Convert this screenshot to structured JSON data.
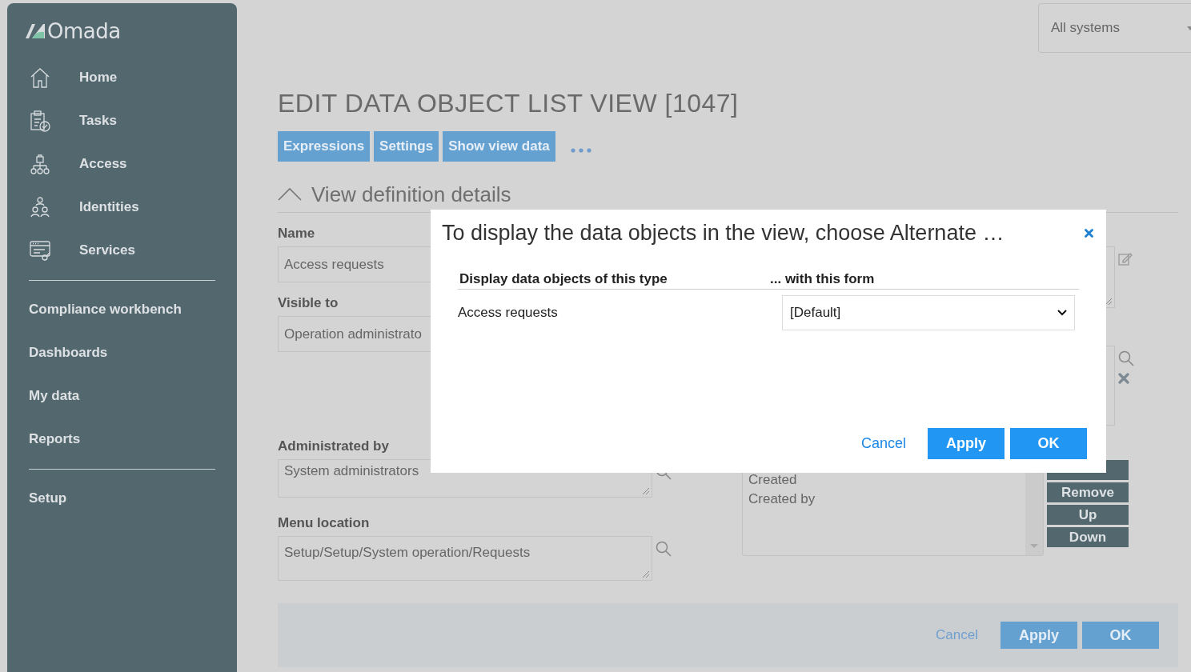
{
  "sidebar": {
    "logo": "Omada",
    "primary_items": [
      {
        "label": "Home"
      },
      {
        "label": "Tasks"
      },
      {
        "label": "Access"
      },
      {
        "label": "Identities"
      },
      {
        "label": "Services"
      }
    ],
    "secondary_items": [
      {
        "label": "Compliance workbench"
      },
      {
        "label": "Dashboards"
      },
      {
        "label": "My data"
      },
      {
        "label": "Reports"
      }
    ],
    "setup_items": [
      {
        "label": "Setup"
      }
    ]
  },
  "system_selector": {
    "value": "All systems"
  },
  "page": {
    "title": "EDIT DATA OBJECT LIST VIEW [1047]",
    "actions": [
      "Expressions",
      "Settings",
      "Show view data"
    ],
    "section": {
      "title": "View definition details",
      "expanded": true
    },
    "fields": [
      {
        "kind": "input",
        "label": "Name",
        "value": "Access requests"
      },
      {
        "kind": "input",
        "label": "Visible to",
        "value": "Operation administrato"
      },
      {
        "kind": "lookup",
        "label": "Administrated by",
        "value": "System administrators"
      },
      {
        "kind": "lookup",
        "label": "Menu location",
        "value": "Setup/Setup/System operation/Requests"
      }
    ],
    "columns_list": {
      "items": [
        "Created",
        "Created by"
      ],
      "buttons": [
        "Remove",
        "Up",
        "Down"
      ]
    },
    "footer": [
      {
        "kind": "link",
        "label": "Cancel"
      },
      {
        "kind": "button",
        "label": "Apply"
      },
      {
        "kind": "button",
        "label": "OK"
      }
    ]
  },
  "dialog": {
    "title": "To display the data objects in the view, choose Alternate …",
    "columns": [
      "Display data objects of this type",
      "... with this form"
    ],
    "rows": [
      {
        "type": "Access requests",
        "form": "[Default]"
      }
    ],
    "buttons": [
      {
        "kind": "link",
        "label": "Cancel"
      },
      {
        "kind": "button",
        "label": "Apply"
      },
      {
        "kind": "button",
        "label": "OK"
      }
    ]
  }
}
